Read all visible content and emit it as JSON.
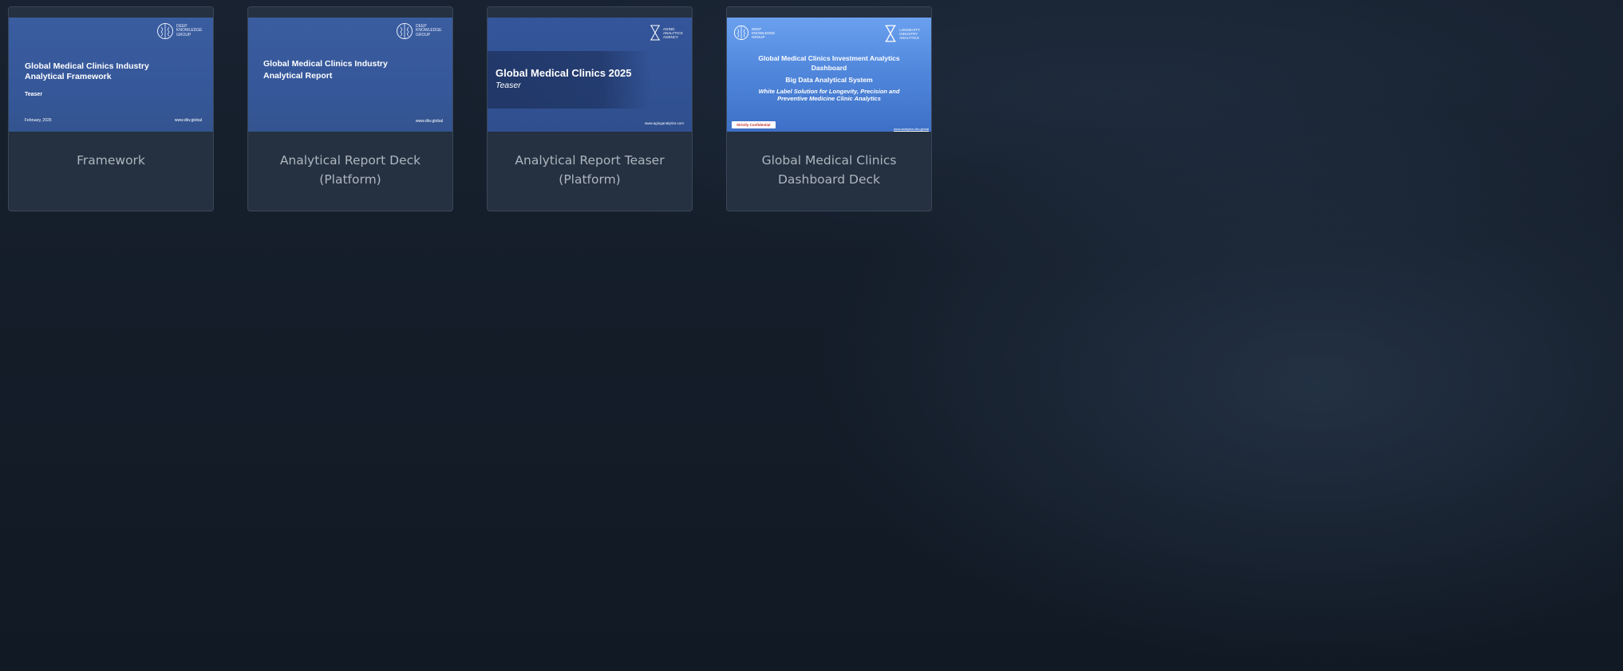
{
  "cards": [
    {
      "caption": "Framework",
      "slide": {
        "logo_text": "DEEP\nKNOWLEDGE\nGROUP",
        "title": "Global Medical Clinics Industry Analytical Framework",
        "subtitle": "Teaser",
        "date": "February, 2025",
        "url": "www.dkv.global"
      }
    },
    {
      "caption": "Analytical Report Deck (Platform)",
      "slide": {
        "logo_text": "DEEP\nKNOWLEDGE\nGROUP",
        "title": "Global Medical Clinics Industry Analytical Report",
        "url": "www.dkv.global"
      }
    },
    {
      "caption": "Analytical Report Teaser (Platform)",
      "slide": {
        "logo_text": "AGING\nANALYTICS\nAGENCY",
        "title": "Global Medical Clinics 2025",
        "subtitle": "Teaser",
        "url": "www.aginganalytics.com"
      }
    },
    {
      "caption": "Global Medical Clinics Dashboard Deck",
      "slide": {
        "logo_left_text": "DEEP\nKNOWLEDGE\nGROUP",
        "logo_right_text": "LONGEVITY\nINDUSTRY\nANALYTICS",
        "title": "Global Medical Clinics Investment Analytics Dashboard",
        "subtitle": "Big Data Analytical System",
        "tagline": "White Label Solution for Longevity, Precision and Preventive Medicine Clinic Analytics",
        "button": "Strictly Confidential",
        "url": "www.analytics.dkv.global"
      }
    }
  ],
  "icons": {
    "brain": "brain-logo-icon",
    "hourglass": "hourglass-logo-icon"
  },
  "colors": {
    "page_bg": "#141d29",
    "card_bg": "#253140",
    "caption_text": "#aeb6c0",
    "slide_blue": "#3a5da0",
    "slide_bright_blue": "#5b90e2",
    "confidential_red": "#c0302c"
  }
}
